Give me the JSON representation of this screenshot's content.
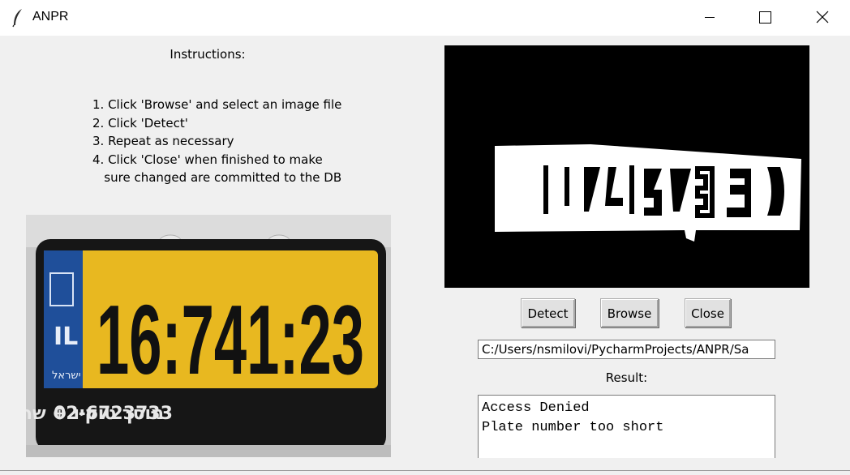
{
  "window": {
    "title": "ANPR",
    "app_icon": "feather-icon",
    "controls": {
      "minimize": "minimize-icon",
      "maximize": "maximize-icon",
      "close": "close-icon"
    }
  },
  "instructions": {
    "title": "Instructions:",
    "lines": [
      "1. Click 'Browse' and select an image file",
      "2. Click 'Detect'",
      "3. Repeat as necessary",
      "4. Click 'Close' when finished to make",
      "   sure changed are committed to the DB"
    ]
  },
  "plate_image": {
    "plate_number": "16:741:23",
    "phone": "02-6723733",
    "dealer_text": "מוסך טוקיו ⊕ שרות סובארו",
    "country_code": "IL",
    "country_script": "ישראל",
    "colors": {
      "plate_yellow": "#e8b820",
      "band_blue": "#1f4f9a",
      "frame": "#1a1a1a"
    }
  },
  "threshold_image": {
    "description_glyphs": "16:741:23",
    "colors": {
      "background": "#000000",
      "foreground": "#ffffff"
    }
  },
  "buttons": {
    "detect": "Detect",
    "browse": "Browse",
    "close": "Close"
  },
  "file_path": {
    "value": "C:/Users/nsmilovi/PycharmProjects/ANPR/Sa"
  },
  "result": {
    "label": "Result:",
    "lines": [
      "Access Denied",
      "Plate number too short"
    ]
  }
}
